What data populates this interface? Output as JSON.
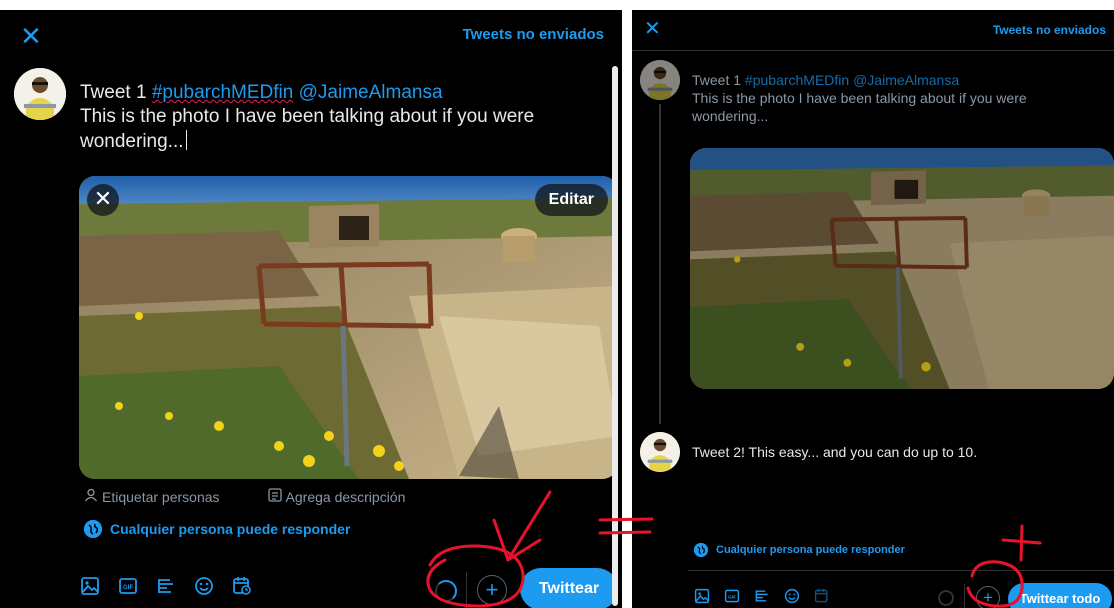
{
  "left": {
    "header": {
      "close_icon": "close-icon",
      "unsent_label": "Tweets no enviados"
    },
    "tweet": {
      "prefix": "Tweet 1 ",
      "hashtag": "#pubarchMEDfin",
      "mention": "@JaimeAlmansa",
      "body": "This is the photo I have been talking about if you were wondering..."
    },
    "media": {
      "close_icon": "close-icon",
      "edit_label": "Editar"
    },
    "meta": {
      "tag_label": "Etiquetar personas",
      "desc_label": "Agrega descripción"
    },
    "reply_setting": "Cualquier persona puede responder",
    "toolbar": {
      "icons": [
        "image-icon",
        "gif-icon",
        "poll-icon",
        "emoji-icon",
        "schedule-icon"
      ],
      "gif_text": "GIF"
    },
    "add_symbol": "+",
    "tweet_button": "Twittear"
  },
  "right": {
    "header": {
      "close_icon": "close-icon",
      "unsent_label": "Tweets no enviados"
    },
    "tweet1": {
      "prefix": "Tweet 1 ",
      "hashtag": "#pubarchMEDfin",
      "mention": "@JaimeAlmansa",
      "body": "This is the photo I have been talking about if you were wondering..."
    },
    "tweet2": {
      "body": "Tweet 2! This easy... and you can do up to 10."
    },
    "reply_setting": "Cualquier persona puede responder",
    "toolbar": {
      "icons": [
        "image-icon",
        "gif-icon",
        "poll-icon",
        "emoji-icon",
        "schedule-icon"
      ],
      "gif_text": "GIF"
    },
    "add_symbol": "+",
    "tweet_all_button": "Twittear todo"
  },
  "colors": {
    "accent": "#1d9bf0",
    "background": "#000000",
    "text": "#e7e9ea",
    "muted": "#8b98a5",
    "annotation": "#e8122a"
  }
}
